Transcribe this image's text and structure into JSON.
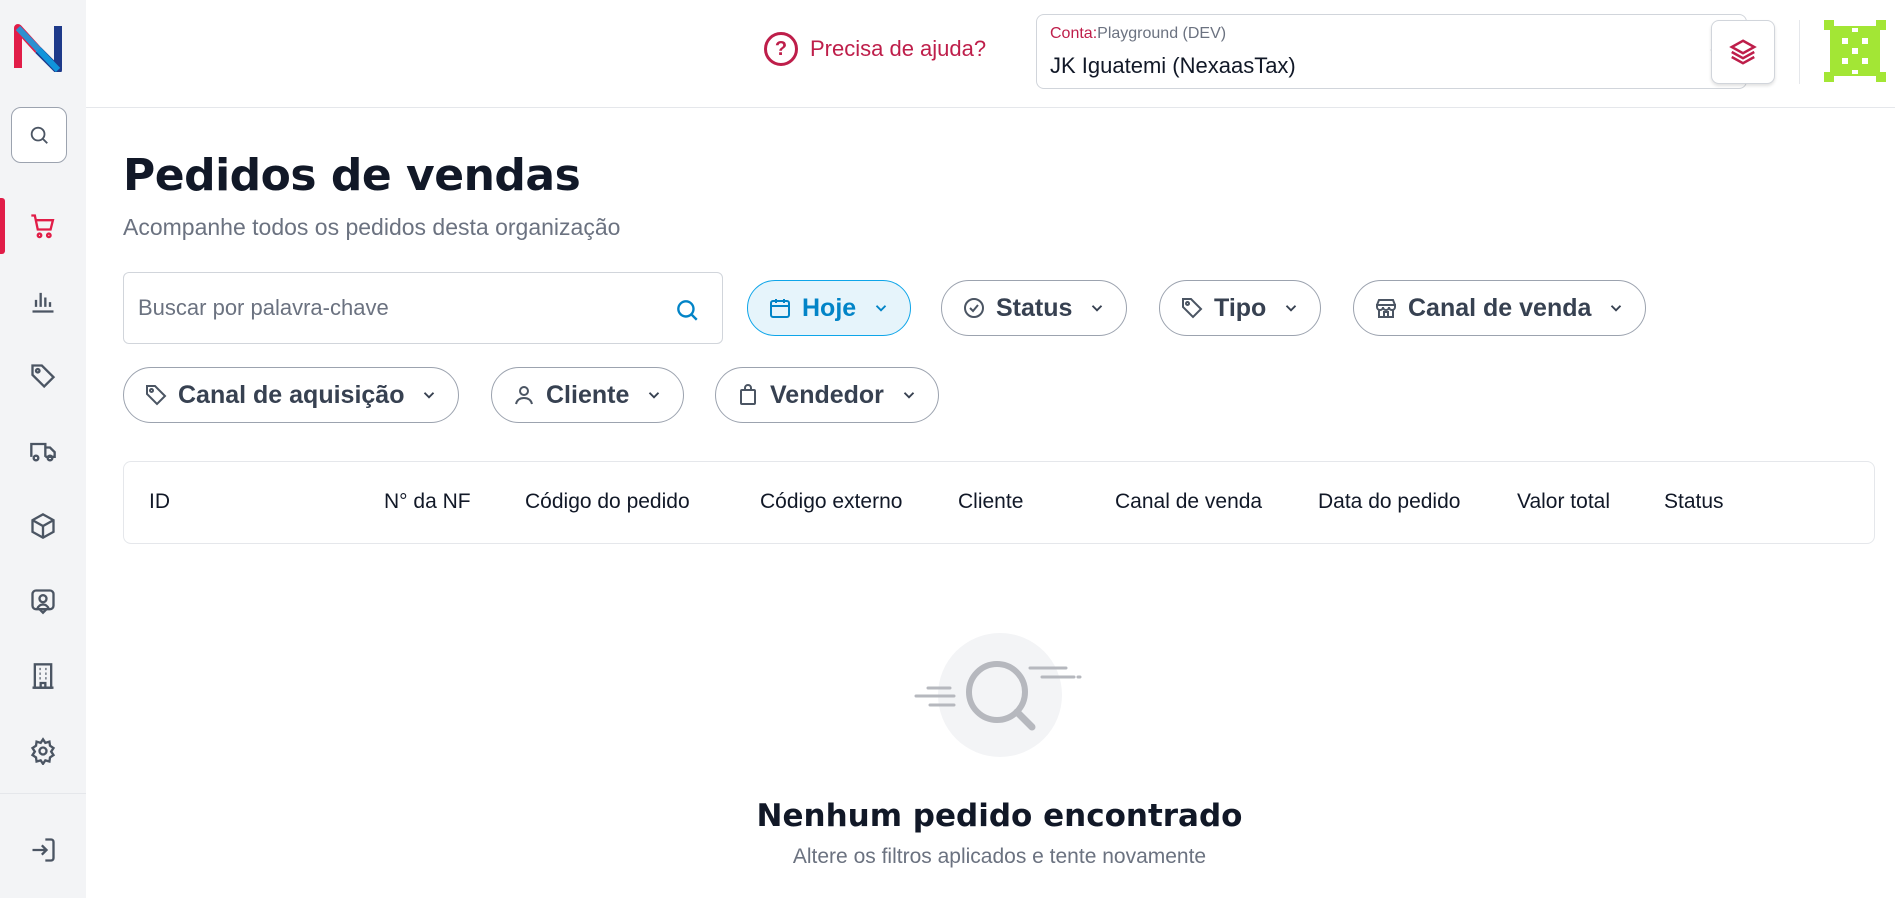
{
  "header": {
    "help_label": "Precisa de ajuda?",
    "account": {
      "label_key": "Conta:",
      "label_value": "Playground (DEV)",
      "selected": "JK Iguatemi (NexaasTax)"
    }
  },
  "page": {
    "title": "Pedidos de vendas",
    "subtitle": "Acompanhe todos os pedidos desta organização"
  },
  "search": {
    "placeholder": "Buscar por palavra-chave",
    "value": ""
  },
  "filters": {
    "date": "Hoje",
    "status": "Status",
    "type": "Tipo",
    "sales_channel": "Canal de venda",
    "acquisition_channel": "Canal de aquisição",
    "customer": "Cliente",
    "seller": "Vendedor"
  },
  "table": {
    "columns": [
      "ID",
      "N° da NF",
      "Código do pedido",
      "Código externo",
      "Cliente",
      "Canal de venda",
      "Data do pedido",
      "Valor total",
      "Status"
    ]
  },
  "empty_state": {
    "title": "Nenhum pedido encontrado",
    "subtitle": "Altere os filtros aplicados e tente novamente"
  },
  "colors": {
    "accent": "#be1e4a",
    "active_filter": "#0284c7",
    "avatar": "#a3e635"
  },
  "sidebar": {
    "items": [
      {
        "icon": "cart-icon",
        "active": true
      },
      {
        "icon": "bar-chart-icon",
        "active": false
      },
      {
        "icon": "tag-icon",
        "active": false
      },
      {
        "icon": "truck-icon",
        "active": false
      },
      {
        "icon": "box-icon",
        "active": false
      },
      {
        "icon": "contact-icon",
        "active": false
      },
      {
        "icon": "building-icon",
        "active": false
      },
      {
        "icon": "gear-icon",
        "active": false
      },
      {
        "icon": "logout-icon",
        "active": false
      }
    ]
  }
}
